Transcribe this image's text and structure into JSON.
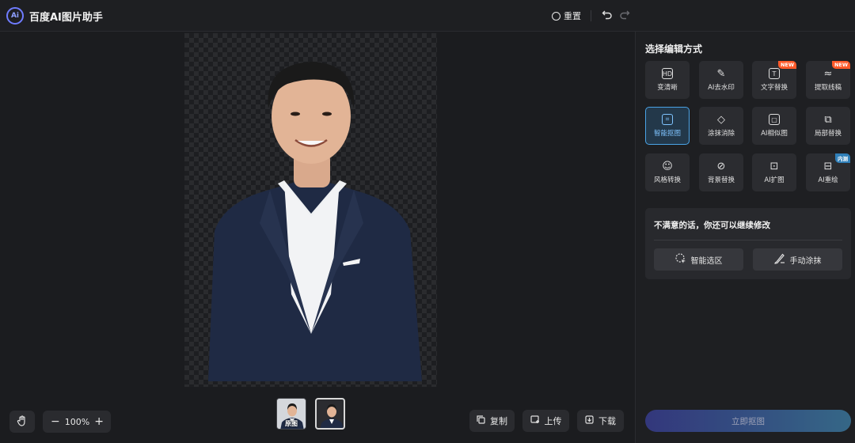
{
  "header": {
    "logo_text": "Ai",
    "title": "百度AI图片助手",
    "reset_label": "重置",
    "undo_icon": "undo-icon",
    "redo_icon": "redo-icon"
  },
  "canvas": {
    "zoom_level": "100%",
    "zoom_minus": "−",
    "zoom_plus": "+",
    "thumbnails": [
      {
        "label": "原图"
      },
      {
        "label": ""
      }
    ],
    "actions": {
      "copy": "复制",
      "upload": "上传",
      "download": "下载"
    }
  },
  "panel": {
    "title": "选择编辑方式",
    "tools": [
      {
        "label": "变清晰",
        "icon": "HD"
      },
      {
        "label": "AI去水印",
        "icon": "✎"
      },
      {
        "label": "文字替换",
        "icon": "T",
        "badge": "NEW"
      },
      {
        "label": "提取线稿",
        "icon": "≈",
        "badge": "NEW"
      },
      {
        "label": "智能抠图",
        "icon": "⌗"
      },
      {
        "label": "涂抹消除",
        "icon": "◇"
      },
      {
        "label": "AI相似图",
        "icon": "▢"
      },
      {
        "label": "局部替换",
        "icon": "⧉"
      },
      {
        "label": "风格转换",
        "icon": "☺"
      },
      {
        "label": "背景替换",
        "icon": "⊘"
      },
      {
        "label": "AI扩图",
        "icon": "⊡"
      },
      {
        "label": "AI重绘",
        "icon": "⊟",
        "badge": "内测"
      }
    ],
    "modify": {
      "title": "不满意的话，你还可以继续修改",
      "smart_select": "智能选区",
      "manual_paint": "手动涂抹"
    },
    "go_button": "立即抠图"
  },
  "colors": {
    "accent": "#4aa3e6",
    "new_badge": "#ff5a2a",
    "beta_badge": "#2f7fb8"
  }
}
